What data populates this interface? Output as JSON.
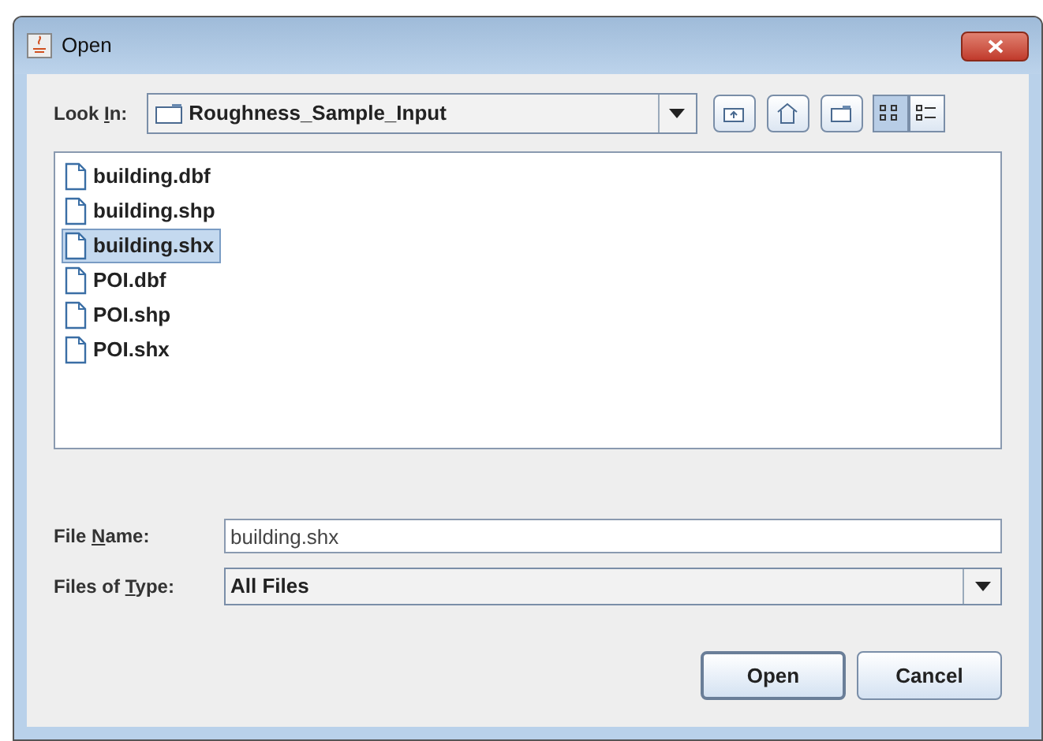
{
  "window": {
    "title": "Open"
  },
  "look_in": {
    "label": {
      "before": "Look ",
      "key": "I",
      "after": "n:"
    },
    "value": "Roughness_Sample_Input"
  },
  "view_buttons": [
    {
      "kind": "list",
      "selected": true
    },
    {
      "kind": "details",
      "selected": false
    }
  ],
  "files": [
    {
      "name": "building.dbf",
      "selected": false
    },
    {
      "name": "building.shp",
      "selected": false
    },
    {
      "name": "building.shx",
      "selected": true
    },
    {
      "name": "POI.dbf",
      "selected": false
    },
    {
      "name": "POI.shp",
      "selected": false
    },
    {
      "name": "POI.shx",
      "selected": false
    }
  ],
  "file_name": {
    "label": {
      "before": "File ",
      "key": "N",
      "after": "ame:"
    },
    "value": "building.shx"
  },
  "file_type": {
    "label": {
      "before": "Files of ",
      "key": "T",
      "after": "ype:"
    },
    "value": "All Files"
  },
  "buttons": [
    {
      "label": "Open",
      "kind": "primary"
    },
    {
      "label": "Cancel",
      "kind": "normal"
    }
  ]
}
